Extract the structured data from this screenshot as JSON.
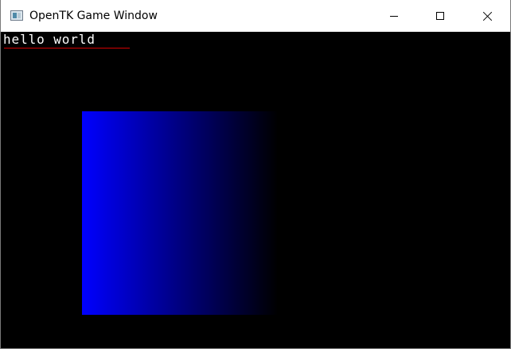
{
  "window": {
    "title": "OpenTK Game Window",
    "app_icon": "app-window-icon",
    "controls": {
      "minimize_icon": "minimize-icon",
      "maximize_icon": "maximize-icon",
      "close_icon": "close-icon"
    }
  },
  "scene": {
    "background_color": "#000000",
    "text": "hello world",
    "text_color": "#ffffff",
    "underline_color": "#d40000",
    "quad": {
      "gradient_start_color": "#0000ff",
      "gradient_end_color": "#000000"
    }
  }
}
